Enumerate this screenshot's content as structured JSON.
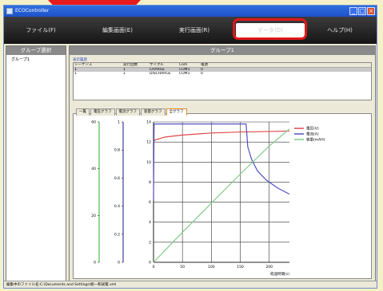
{
  "window": {
    "title": "ECOController"
  },
  "menu": {
    "items": [
      {
        "label": "ファイル(F)",
        "x": 0
      },
      {
        "label": "編集画面(E)"
      },
      {
        "label": "実行画面(R)"
      },
      {
        "label": "データ(D)"
      },
      {
        "label": "ヘルプ(H)"
      }
    ]
  },
  "left": {
    "header": "グループ選択",
    "items": [
      "グループ1"
    ]
  },
  "right": {
    "header": "グループ1",
    "info_label": "表示履歴",
    "table": {
      "columns": [
        "シーケンス",
        "実行回数",
        "サイクル",
        "Com",
        "電源"
      ],
      "rows": [
        [
          "1",
          "1",
          "CHARGE",
          "COM1",
          "0"
        ],
        [
          "1",
          "1",
          "DISCHARGE",
          "COM1",
          "0"
        ]
      ]
    },
    "tabs": [
      "一覧",
      "電圧グラフ",
      "電流グラフ",
      "容量グラフ",
      "全グラフ"
    ]
  },
  "chart_data": {
    "type": "line",
    "xlabel": "経過時間(s)",
    "x_ticks": [
      "0",
      "50",
      "100",
      "150",
      "200"
    ],
    "xlim": [
      0,
      235
    ],
    "axes": [
      {
        "id": "left1",
        "ticks": [
          "60",
          "40",
          "20",
          "0"
        ],
        "ylim": [
          0,
          60
        ],
        "color": "#4cbf4c"
      },
      {
        "id": "left2",
        "ticks": [
          "1",
          "0.8",
          "0.6",
          "0.4",
          "0.2",
          "0"
        ],
        "ylim": [
          0,
          1
        ],
        "color": "#3e3ea8"
      },
      {
        "id": "right",
        "ticks": [
          "14",
          "12",
          "10",
          "8",
          "6",
          "4",
          "2",
          "0"
        ],
        "ylim": [
          0,
          14
        ],
        "color": "#d63a3a"
      }
    ],
    "series": [
      {
        "name": "電圧(V)",
        "color": "#e04848",
        "x": [
          0,
          2,
          20,
          50,
          100,
          150,
          200,
          235
        ],
        "y": [
          12.0,
          12.2,
          12.5,
          12.7,
          12.9,
          13.0,
          13.05,
          13.1
        ]
      },
      {
        "name": "電流(A)",
        "color": "#5050c0",
        "x": [
          0,
          1,
          2,
          4,
          155,
          160,
          163,
          170,
          180,
          195,
          215,
          235
        ],
        "y": [
          6.2,
          13.8,
          13.8,
          13.8,
          13.8,
          13.8,
          11.5,
          10.2,
          9.1,
          8.2,
          7.4,
          6.8
        ]
      },
      {
        "name": "容量(mAH)",
        "color": "#80cc88",
        "x": [
          0,
          50,
          100,
          150,
          200,
          235
        ],
        "y": [
          0,
          3.0,
          5.9,
          8.8,
          11.6,
          13.3
        ]
      }
    ]
  },
  "status": {
    "text": "編集中のファイル名:C:\\Documents and Settings\\統一和試電.xml"
  }
}
